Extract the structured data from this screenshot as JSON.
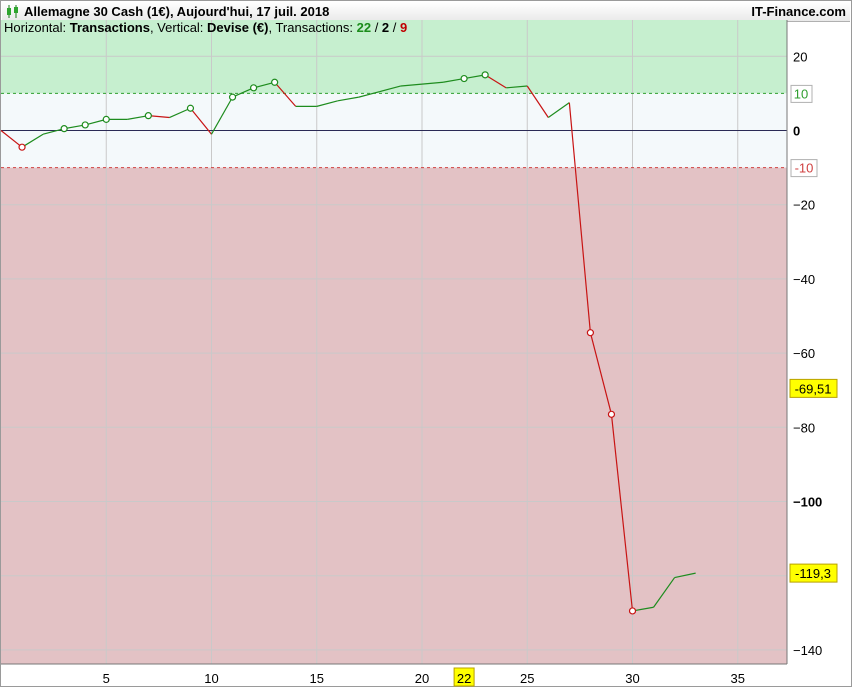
{
  "header": {
    "title": "Allemagne 30 Cash (1€), Aujourd'hui, 17 juil. 2018",
    "site": "IT-Finance.com",
    "subtitle_prefix1": "Horizontal: ",
    "subtitle_h": "Transactions",
    "subtitle_prefix2": ", Vertical: ",
    "subtitle_v": "Devise (€)",
    "subtitle_prefix3": ", Transactions: ",
    "trades_total": "22",
    "trades_sep1": " / ",
    "trades_mid": "2",
    "trades_sep2": " / ",
    "trades_red": "9"
  },
  "colors": {
    "profit_zone": "#c6efcf",
    "neutral_zone": "#f4f9fb",
    "loss_zone": "#e3c2c5",
    "up_line": "#1e8c1e",
    "down_line": "#c81414",
    "marker_label_bg": "#ffff00"
  },
  "chart_data": {
    "type": "line",
    "x_axis": {
      "label": "Transactions",
      "range": [
        0,
        37
      ],
      "ticks": [
        5,
        10,
        15,
        20,
        25,
        30,
        35
      ],
      "highlight": "22"
    },
    "y_axis": {
      "label": "Devise (€)",
      "range": [
        -143,
        30
      ],
      "ticks": [
        20,
        0,
        -20,
        -40,
        -60,
        -80,
        -100,
        -120,
        -140
      ],
      "tick_labels": [
        "20",
        "0",
        "−20",
        "−40",
        "−60",
        "−80",
        "−100",
        "",
        "−140"
      ],
      "bold_ticks": [
        "0",
        "−100"
      ]
    },
    "zones": {
      "upper": 10,
      "lower": -10,
      "upper_label": "10",
      "lower_label": "-10"
    },
    "value_labels": [
      {
        "value": -69.51,
        "text": "-69,51"
      },
      {
        "value": -119.3,
        "text": "-119,3"
      }
    ],
    "series": [
      {
        "x": [
          0,
          1,
          2,
          3,
          4,
          5,
          6,
          7,
          8,
          9,
          10,
          11,
          12,
          13,
          14,
          15,
          16,
          17,
          18,
          19,
          20,
          21,
          22,
          23,
          24,
          25,
          26,
          27,
          28,
          29,
          30,
          31,
          32,
          33
        ],
        "y": [
          0,
          -4.5,
          -1,
          0.5,
          1.5,
          3,
          3,
          4,
          3.5,
          6,
          -1,
          9,
          11.5,
          13,
          6.5,
          6.5,
          8,
          9,
          10.5,
          12,
          12.5,
          13,
          14,
          15,
          11.5,
          12,
          3.5,
          7.5,
          -54.5,
          -76.5,
          -129.5,
          -128.5,
          -120.5,
          -119.3
        ],
        "markers": [
          1,
          3,
          4,
          5,
          7,
          9,
          11,
          12,
          13,
          22,
          23,
          28,
          29,
          30
        ]
      }
    ]
  }
}
